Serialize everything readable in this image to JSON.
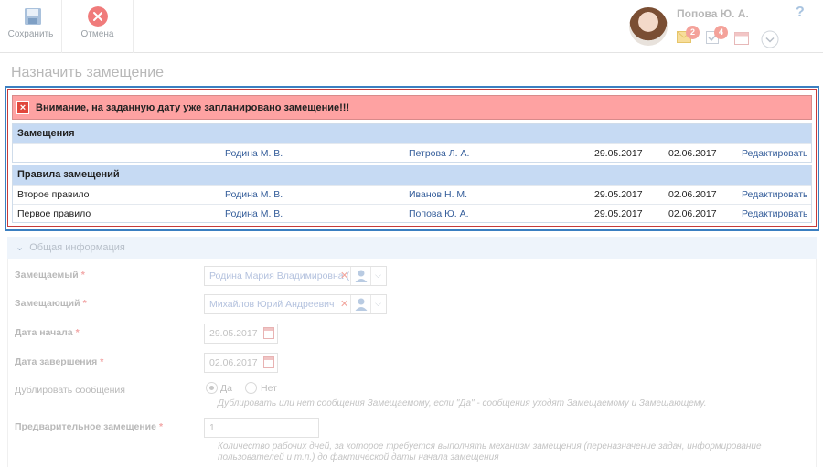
{
  "toolbar": {
    "save_label": "Сохранить",
    "cancel_label": "Отмена"
  },
  "user": {
    "name": "Попова Ю. А.",
    "mail_count": "2",
    "tasks_count": "4"
  },
  "help_label": "?",
  "page_title": "Назначить замещение",
  "warning": {
    "message": "Внимание, на заданную дату уже запланировано замещение!!!",
    "substitutions_header": "Замещения",
    "substitutions": [
      {
        "rule": "",
        "replaced": "Родина М. В.",
        "replacer": "Петрова Л. А.",
        "start": "29.05.2017",
        "end": "02.06.2017",
        "edit": "Редактировать"
      }
    ],
    "rules_header": "Правила замещений",
    "rules": [
      {
        "rule": "Второе правило",
        "replaced": "Родина М. В.",
        "replacer": "Иванов Н. М.",
        "start": "29.05.2017",
        "end": "02.06.2017",
        "edit": "Редактировать"
      },
      {
        "rule": "Первое правило",
        "replaced": "Родина М. В.",
        "replacer": "Попова Ю. А.",
        "start": "29.05.2017",
        "end": "02.06.2017",
        "edit": "Редактировать"
      }
    ]
  },
  "form": {
    "section_title": "Общая информация",
    "replaced_label": "Замещаемый",
    "replaced_value": "Родина Мария Владимировна (",
    "replacer_label": "Замещающий",
    "replacer_value": "Михайлов Юрий Андреевич",
    "start_label": "Дата начала",
    "start_value": "29.05.2017",
    "end_label": "Дата завершения",
    "end_value": "02.06.2017",
    "duplicate_label": "Дублировать сообщения",
    "duplicate_yes": "Да",
    "duplicate_no": "Нет",
    "duplicate_hint": "Дублировать или нет сообщения Замещаемому, если \"Да\" - сообщения уходят Замещаемому и Замещающему.",
    "prelim_label": "Предварительное замещение",
    "prelim_value": "1",
    "prelim_hint_1": "Количество рабочих дней, за которое требуется выполнять механизм замещения (переназначение задач, информирование",
    "prelim_hint_2": "пользователей и т.п.) до фактической даты начала замещения",
    "required_mark": "*"
  }
}
